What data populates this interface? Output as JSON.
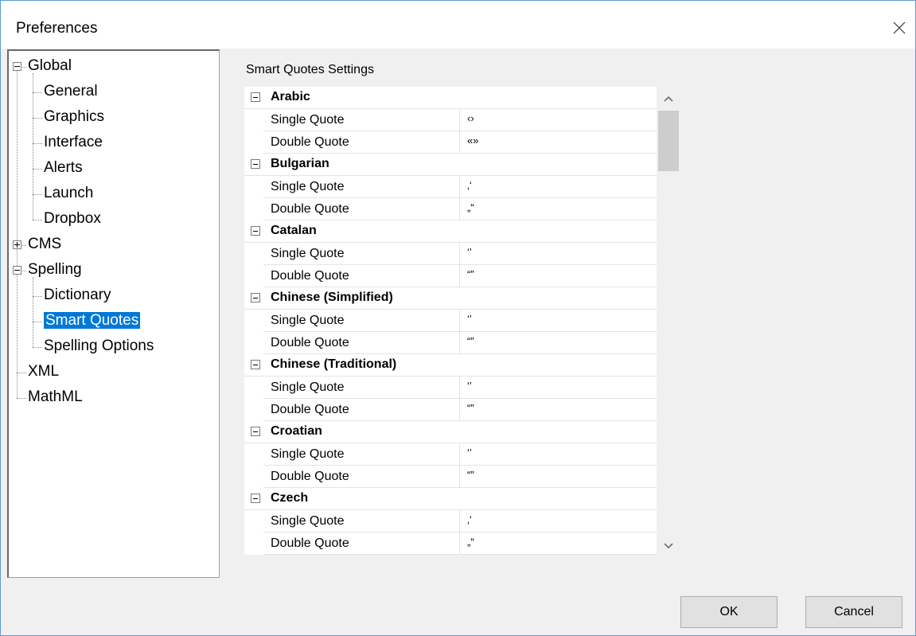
{
  "window": {
    "title": "Preferences"
  },
  "tree": {
    "items": [
      {
        "label": "Global",
        "level": 0,
        "expander": "minus"
      },
      {
        "label": "General",
        "level": 1
      },
      {
        "label": "Graphics",
        "level": 1
      },
      {
        "label": "Interface",
        "level": 1
      },
      {
        "label": "Alerts",
        "level": 1
      },
      {
        "label": "Launch",
        "level": 1
      },
      {
        "label": "Dropbox",
        "level": 1
      },
      {
        "label": "CMS",
        "level": 0,
        "expander": "plus"
      },
      {
        "label": "Spelling",
        "level": 0,
        "expander": "minus"
      },
      {
        "label": "Dictionary",
        "level": 1
      },
      {
        "label": "Smart Quotes",
        "level": 1,
        "selected": true
      },
      {
        "label": "Spelling Options",
        "level": 1
      },
      {
        "label": "XML",
        "level": 0
      },
      {
        "label": "MathML",
        "level": 0
      }
    ]
  },
  "settings": {
    "title": "Smart Quotes Settings",
    "single_label": "Single Quote",
    "double_label": "Double Quote",
    "languages": [
      {
        "name": "Arabic",
        "single": "‹›",
        "double": "«»"
      },
      {
        "name": "Bulgarian",
        "single": "‚‘",
        "double": "„“"
      },
      {
        "name": "Catalan",
        "single": "‘’",
        "double": "“”"
      },
      {
        "name": "Chinese (Simplified)",
        "single": "‘’",
        "double": "“”"
      },
      {
        "name": "Chinese (Traditional)",
        "single": "‘’",
        "double": "“”"
      },
      {
        "name": "Croatian",
        "single": "‘’",
        "double": "“”"
      },
      {
        "name": "Czech",
        "single": "‚‘",
        "double": "„“"
      }
    ]
  },
  "buttons": {
    "ok": "OK",
    "cancel": "Cancel"
  },
  "colors": {
    "selection": "#0078d7",
    "accent_border": "#5b9bd5"
  }
}
